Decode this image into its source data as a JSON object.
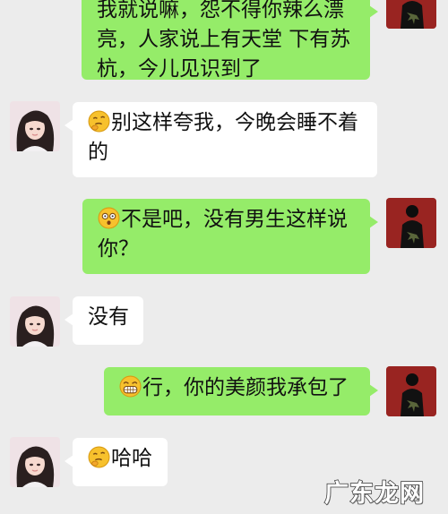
{
  "messages": [
    {
      "side": "right",
      "text": "我就说嘛，怨不得你辣么漂亮，人家说上有天堂 下有苏杭，今儿见识到了"
    },
    {
      "side": "left",
      "emoji": "thinking-face-icon",
      "text": "别这样夸我，今晚会睡不着的"
    },
    {
      "side": "right",
      "emoji": "surprised-face-icon",
      "text": "不是吧，没有男生这样说你？"
    },
    {
      "side": "left",
      "text": "没有"
    },
    {
      "side": "right",
      "emoji": "grinning-face-icon",
      "text": "行，你的美颜我承包了"
    },
    {
      "side": "left",
      "emoji": "thinking-face-icon",
      "text": "哈哈"
    }
  ],
  "watermark": "广东龙网",
  "colors": {
    "background": "#ececec",
    "sent_bubble": "#95ec69",
    "received_bubble": "#ffffff"
  }
}
